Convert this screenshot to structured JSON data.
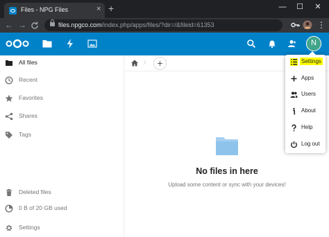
{
  "browser": {
    "tab_title": "Files - NPG Files",
    "tab_close": "×",
    "new_tab": "+",
    "window_controls": {
      "minimize": "—",
      "maximize": "☐",
      "close": "✕"
    },
    "url_host": "files.npgco.com",
    "url_path": "/index.php/apps/files/?dir=/&fileid=61353"
  },
  "header": {
    "avatar_initial": "N"
  },
  "sidebar": {
    "items": [
      {
        "label": "All files",
        "icon": "folder-icon",
        "active": true
      },
      {
        "label": "Recent",
        "icon": "clock-icon"
      },
      {
        "label": "Favorites",
        "icon": "star-icon"
      },
      {
        "label": "Shares",
        "icon": "share-icon"
      },
      {
        "label": "Tags",
        "icon": "tag-icon"
      }
    ],
    "deleted_files": "Deleted files",
    "quota": "0 B of 20 GB used",
    "settings": "Settings"
  },
  "content": {
    "add_label": "+",
    "empty_title": "No files in here",
    "empty_subtitle": "Upload some content or sync with your devices!"
  },
  "settings_menu": {
    "items": [
      {
        "label": "Settings",
        "icon": "settings-list-icon",
        "highlighted": true
      },
      {
        "label": "Apps",
        "icon": "plus-icon"
      },
      {
        "label": "Users",
        "icon": "users-icon"
      },
      {
        "label": "About",
        "icon": "info-icon"
      },
      {
        "label": "Help",
        "icon": "help-icon"
      },
      {
        "label": "Log out",
        "icon": "power-icon"
      }
    ]
  },
  "colors": {
    "brand": "#0082c9",
    "highlight": "#ffff00",
    "avatar": "#41a58b"
  }
}
